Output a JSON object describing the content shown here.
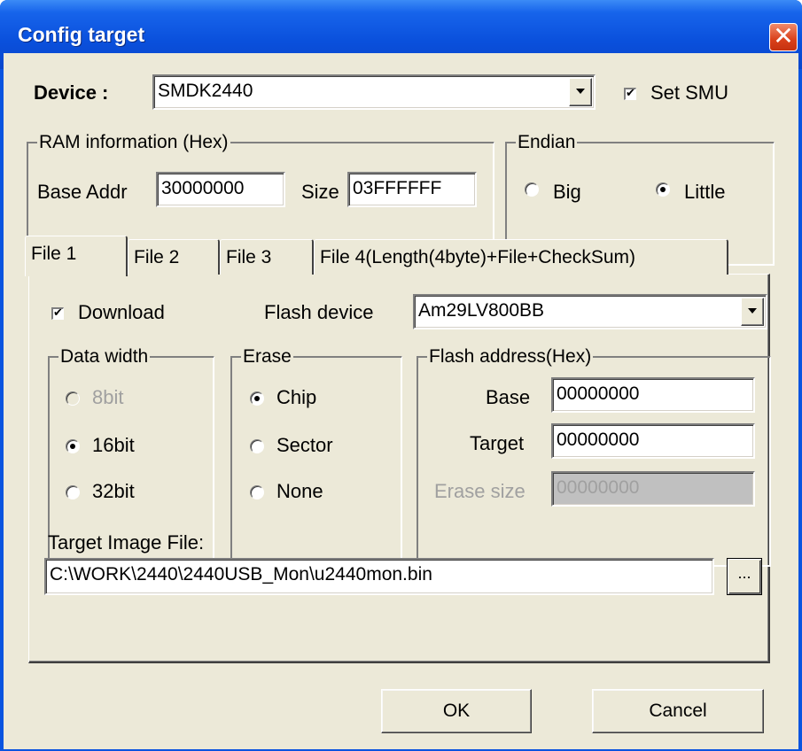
{
  "window": {
    "title": "Config target",
    "close_glyph": "✕"
  },
  "device": {
    "label": "Device :",
    "selected": "SMDK2440",
    "set_smu_label": "Set SMU",
    "set_smu_checked": true
  },
  "ram": {
    "group_title": "RAM information (Hex)",
    "base_label": "Base Addr",
    "base_value": "30000000",
    "size_label": "Size",
    "size_value": "03FFFFFF"
  },
  "endian": {
    "group_title": "Endian",
    "big_label": "Big",
    "little_label": "Little",
    "selected": "Little"
  },
  "tabs": [
    {
      "label": "File 1",
      "active": true
    },
    {
      "label": "File 2",
      "active": false
    },
    {
      "label": "File 3",
      "active": false
    },
    {
      "label": "File 4(Length(4byte)+File+CheckSum)",
      "active": false
    }
  ],
  "file_panel": {
    "download_label": "Download",
    "download_checked": true,
    "flash_device_label": "Flash device",
    "flash_device_selected": "Am29LV800BB",
    "data_width": {
      "group_title": "Data width",
      "options": [
        "8bit",
        "16bit",
        "32bit"
      ],
      "selected": "16bit",
      "disabled": [
        "8bit"
      ]
    },
    "erase": {
      "group_title": "Erase",
      "options": [
        "Chip",
        "Sector",
        "None"
      ],
      "selected": "Chip"
    },
    "flash_address": {
      "group_title": "Flash address(Hex)",
      "base_label": "Base",
      "base_value": "00000000",
      "target_label": "Target",
      "target_value": "00000000",
      "erase_size_label": "Erase size",
      "erase_size_value": "00000000",
      "erase_size_disabled": true
    },
    "target_image_label": "Target Image File:",
    "target_image_path": "C:\\WORK\\2440\\2440USB_Mon\\u2440mon.bin",
    "browse_label": "..."
  },
  "buttons": {
    "ok_label": "OK",
    "cancel_label": "Cancel"
  },
  "colors": {
    "titlebar": "#0a50dc",
    "dialog_face": "#ece9d8",
    "close_button": "#d9401a"
  },
  "icons": {
    "close": "close-icon",
    "dropdown": "chevron-down-icon",
    "checkbox": "checkmark-icon",
    "browse": "ellipsis-icon"
  }
}
